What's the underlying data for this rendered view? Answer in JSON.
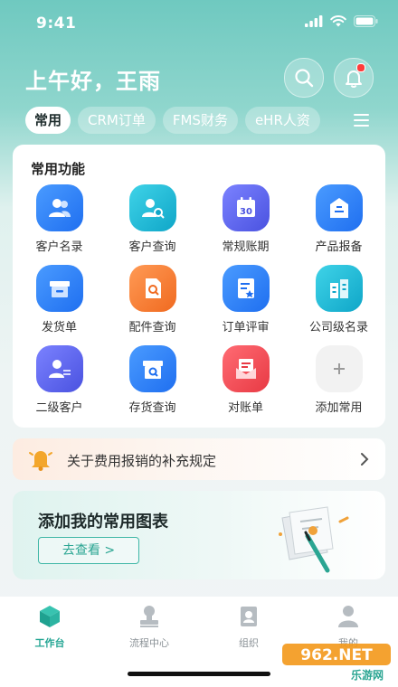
{
  "status_bar": {
    "time": "9:41"
  },
  "header": {
    "greeting": "上午好，王雨"
  },
  "tabs": [
    {
      "label": "常用",
      "active": true
    },
    {
      "label": "CRM订单",
      "active": false
    },
    {
      "label": "FMS财务",
      "active": false
    },
    {
      "label": "eHR人资",
      "active": false
    }
  ],
  "functions": {
    "title": "常用功能",
    "items": [
      {
        "label": "客户名录",
        "icon": "customer-list-icon",
        "color": "#2f7ff5"
      },
      {
        "label": "客户查询",
        "icon": "customer-search-icon",
        "color": "#17b9d6"
      },
      {
        "label": "常规账期",
        "icon": "calendar-icon",
        "color": "#5a63e8"
      },
      {
        "label": "产品报备",
        "icon": "product-report-icon",
        "color": "#2f7ff5"
      },
      {
        "label": "发货单",
        "icon": "delivery-box-icon",
        "color": "#2f7ff5"
      },
      {
        "label": "配件查询",
        "icon": "parts-search-icon",
        "color": "#f3762f"
      },
      {
        "label": "订单评审",
        "icon": "order-review-icon",
        "color": "#2f7ff5"
      },
      {
        "label": "公司级名录",
        "icon": "company-building-icon",
        "color": "#17b9d6"
      },
      {
        "label": "二级客户",
        "icon": "secondary-customer-icon",
        "color": "#5a63e8"
      },
      {
        "label": "存货查询",
        "icon": "inventory-search-icon",
        "color": "#2f7ff5"
      },
      {
        "label": "对账单",
        "icon": "statement-icon",
        "color": "#f0454f"
      },
      {
        "label": "添加常用",
        "icon": "add-icon",
        "color": "#f1f1f1"
      }
    ]
  },
  "notice": {
    "text": "关于费用报销的补充规定"
  },
  "chart_card": {
    "title": "添加我的常用图表",
    "button": "去查看 >"
  },
  "bottom_nav": [
    {
      "label": "工作台",
      "icon": "workbench-cube-icon",
      "active": true
    },
    {
      "label": "流程中心",
      "icon": "process-stamp-icon",
      "active": false
    },
    {
      "label": "组织",
      "icon": "organization-contacts-icon",
      "active": false
    },
    {
      "label": "我的",
      "icon": "profile-person-icon",
      "active": false
    }
  ],
  "watermark": {
    "text_top": "962.NET",
    "text_bottom": "乐游网"
  }
}
